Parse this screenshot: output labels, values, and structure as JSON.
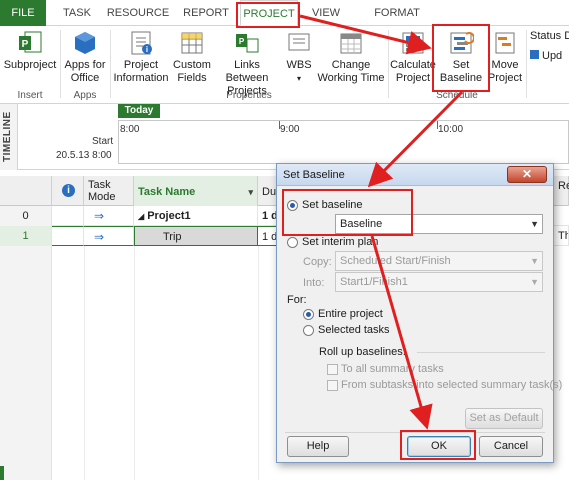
{
  "tabs": [
    "FILE",
    "TASK",
    "RESOURCE",
    "REPORT",
    "PROJECT",
    "VIEW",
    "FORMAT"
  ],
  "ribbon": {
    "subproject": "Subproject",
    "apps_for_office": [
      "Apps for",
      "Office"
    ],
    "project_information": [
      "Project",
      "Information"
    ],
    "custom_fields": [
      "Custom",
      "Fields"
    ],
    "links_between_projects": [
      "Links Between",
      "Projects"
    ],
    "wbs": "WBS",
    "change_working_time": [
      "Change",
      "Working Time"
    ],
    "calculate_project": [
      "Calculate",
      "Project"
    ],
    "set_baseline": [
      "Set",
      "Baseline"
    ],
    "move_project": [
      "Move",
      "Project"
    ],
    "status_date": "Status Da",
    "update": "Upd",
    "groups": {
      "insert": "Insert",
      "apps": "Apps",
      "properties": "Properties",
      "schedule": "Schedule"
    }
  },
  "timeline": {
    "label": "TIMELINE",
    "today": "Today",
    "start_label": "Start",
    "start_date": "20.5.13 8:00",
    "ticks": [
      "8:00",
      "9:00",
      "10:00"
    ]
  },
  "grid": {
    "headers": {
      "task_mode": [
        "Task",
        "Mode"
      ],
      "task_name": "Task Name",
      "duration": "Du",
      "right": "Re"
    },
    "rows": [
      {
        "num": "0",
        "name": "Project1",
        "duration": "1 d"
      },
      {
        "num": "1",
        "name": "Trip",
        "duration": "1 d",
        "right": "Th"
      }
    ]
  },
  "dialog": {
    "title": "Set Baseline",
    "set_baseline": "Set baseline",
    "baseline_value": "Baseline",
    "set_interim_plan": "Set interim plan",
    "copy_label": "Copy:",
    "copy_value": "Scheduled Start/Finish",
    "into_label": "Into:",
    "into_value": "Start1/Finish1",
    "for_label": "For:",
    "entire_project": "Entire project",
    "selected_tasks": "Selected tasks",
    "roll_up": "Roll up baselines:",
    "to_all_summary": "To all summary tasks",
    "from_subtasks": "From subtasks into selected summary task(s)",
    "set_as_default": "Set as Default",
    "help": "Help",
    "ok": "OK",
    "cancel": "Cancel"
  },
  "colors": {
    "accent": "#2b7a2f",
    "annotation": "#e02020"
  }
}
